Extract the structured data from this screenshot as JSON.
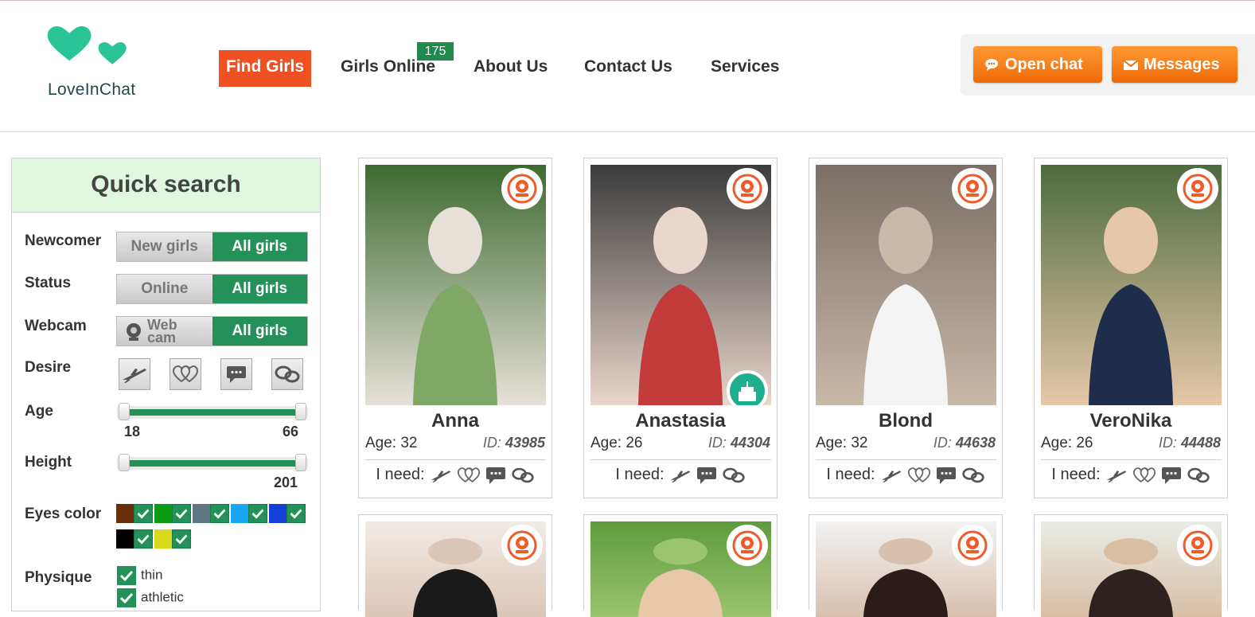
{
  "brand": {
    "name": "LoveInChat",
    "primary": "#2bc497",
    "accent": "#f05123",
    "green": "#249158",
    "orange": "#f57e0d"
  },
  "nav": {
    "items": [
      {
        "label": "Find Girls",
        "active": true
      },
      {
        "label": "Girls Online",
        "active": false
      },
      {
        "label": "About Us",
        "active": false
      },
      {
        "label": "Contact Us",
        "active": false
      },
      {
        "label": "Services",
        "active": false
      }
    ],
    "online_count": "175"
  },
  "actions": {
    "open_chat": "Open chat",
    "messages": "Messages"
  },
  "search": {
    "title": "Quick search",
    "newcomer": {
      "label": "Newcomer",
      "options": [
        "New girls",
        "All girls"
      ],
      "selected": "All girls"
    },
    "status": {
      "label": "Status",
      "options": [
        "Online",
        "All girls"
      ],
      "selected": "All girls"
    },
    "webcam": {
      "label": "Webcam",
      "options": [
        "Web cam",
        "All girls"
      ],
      "selected": "All girls"
    },
    "desire": {
      "label": "Desire",
      "icons": [
        "plane-icon",
        "hearts-icon",
        "chat-bubble-icon",
        "speech-bubbles-icon"
      ]
    },
    "age": {
      "label": "Age",
      "min": "18",
      "max": "66"
    },
    "height": {
      "label": "Height",
      "max": "201"
    },
    "eyes": {
      "label": "Eyes color",
      "colors": [
        "#6b2e0a",
        "#0b9a14",
        "#5f7782",
        "#17a7f2",
        "#1440d8",
        "#000000",
        "#d8d81c"
      ]
    },
    "physique": {
      "label": "Physique",
      "options": [
        "thin",
        "athletic"
      ]
    }
  },
  "profiles": [
    {
      "name": "Anna",
      "age": "Age: 32",
      "id_label": "ID:",
      "id": "43985",
      "needs_label": "I need:",
      "needs": [
        "plane",
        "hearts",
        "chat",
        "bubbles"
      ],
      "gift": false
    },
    {
      "name": "Anastasia",
      "age": "Age: 26",
      "id_label": "ID:",
      "id": "44304",
      "needs_label": "I need:",
      "needs": [
        "plane",
        "chat",
        "bubbles"
      ],
      "gift": true
    },
    {
      "name": "Blond",
      "age": "Age: 32",
      "id_label": "ID:",
      "id": "44638",
      "needs_label": "I need:",
      "needs": [
        "plane",
        "hearts",
        "chat",
        "bubbles"
      ],
      "gift": false
    },
    {
      "name": "VeroNika",
      "age": "Age: 26",
      "id_label": "ID:",
      "id": "44488",
      "needs_label": "I need:",
      "needs": [
        "plane",
        "hearts",
        "chat",
        "bubbles"
      ],
      "gift": false
    }
  ]
}
